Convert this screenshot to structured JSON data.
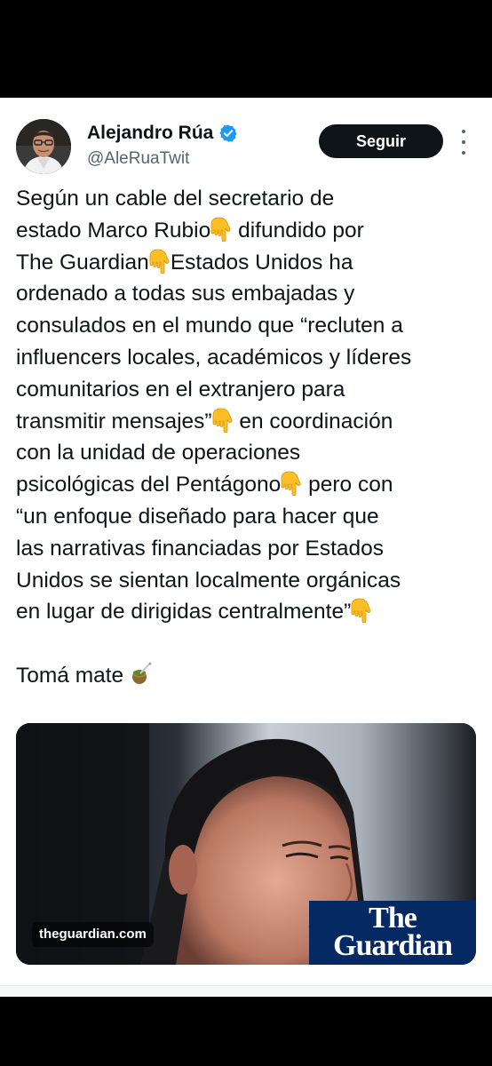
{
  "tweet": {
    "author": {
      "name": "Alejandro Rúa",
      "handle": "@AleRuaTwit",
      "verified": true
    },
    "follow_label": "Seguir",
    "lines": [
      "Según un cable del secretario de",
      "estado Marco Rubio",
      "difundido por",
      "The Guardian",
      "Estados Unidos ha",
      "ordenado a todas sus embajadas y",
      "consulados en el mundo que “recluten a",
      "influencers locales, académicos y líderes",
      "comunitarios en el extranjero para",
      "transmitir mensajes”",
      "en coordinación",
      "con la unidad de operaciones",
      "psicológicas del Pentágono",
      "pero con",
      "“un enfoque diseñado para hacer que",
      "las narrativas financiadas por Estados",
      "Unidos se sientan localmente orgánicas",
      "en lugar de dirigidas centralmente”",
      "Tomá mate"
    ],
    "emoji": {
      "pointing_down": "backhand-index-pointing-down-icon",
      "mate": "mate-icon"
    },
    "media": {
      "domain": "theguardian.com",
      "logo_line1": "The",
      "logo_line2": "Guardian"
    }
  },
  "colors": {
    "follow_button_bg": "#0f1419",
    "verified_blue": "#1d9bf0",
    "guardian_blue": "#052962",
    "text": "#0f1419",
    "secondary_text": "#536471"
  }
}
